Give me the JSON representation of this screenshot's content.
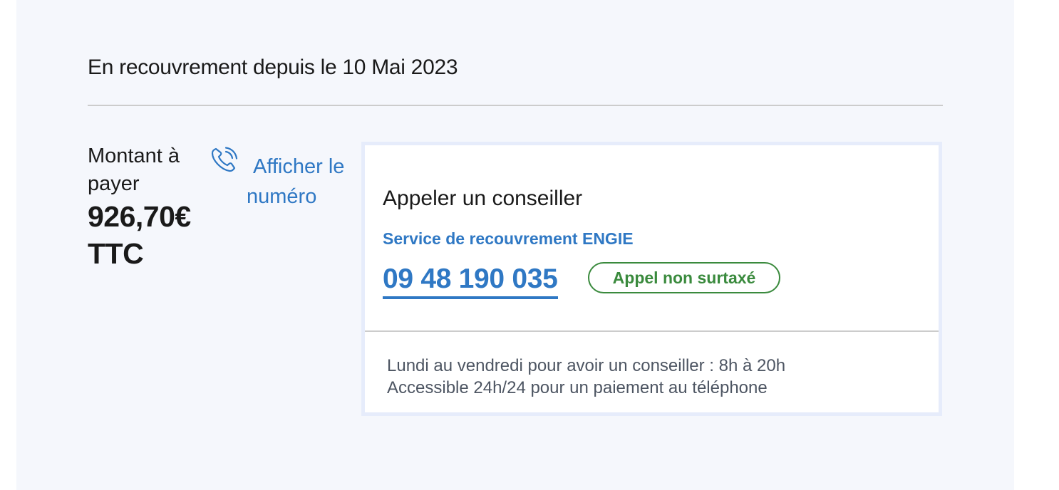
{
  "status": {
    "text": "En recouvrement depuis le 10 Mai 2023"
  },
  "amount": {
    "label": "Montant à payer",
    "value": "926,70€ TTC"
  },
  "show_number": {
    "label": "Afficher le numéro",
    "icon": "phone-icon"
  },
  "call_card": {
    "title": "Appeler un conseiller",
    "subtitle": "Service de recouvrement ENGIE",
    "phone_number": "09 48 190 035",
    "badge": "Appel non surtaxé",
    "hours_line1": "Lundi au vendredi pour avoir un conseiller : 8h à 20h",
    "hours_line2": "Accessible 24h/24 pour un paiement au téléphone"
  },
  "colors": {
    "background": "#f5f7fc",
    "accent_blue": "#2f78c4",
    "badge_green": "#3a8a3d",
    "card_border": "#e6ecfb"
  }
}
